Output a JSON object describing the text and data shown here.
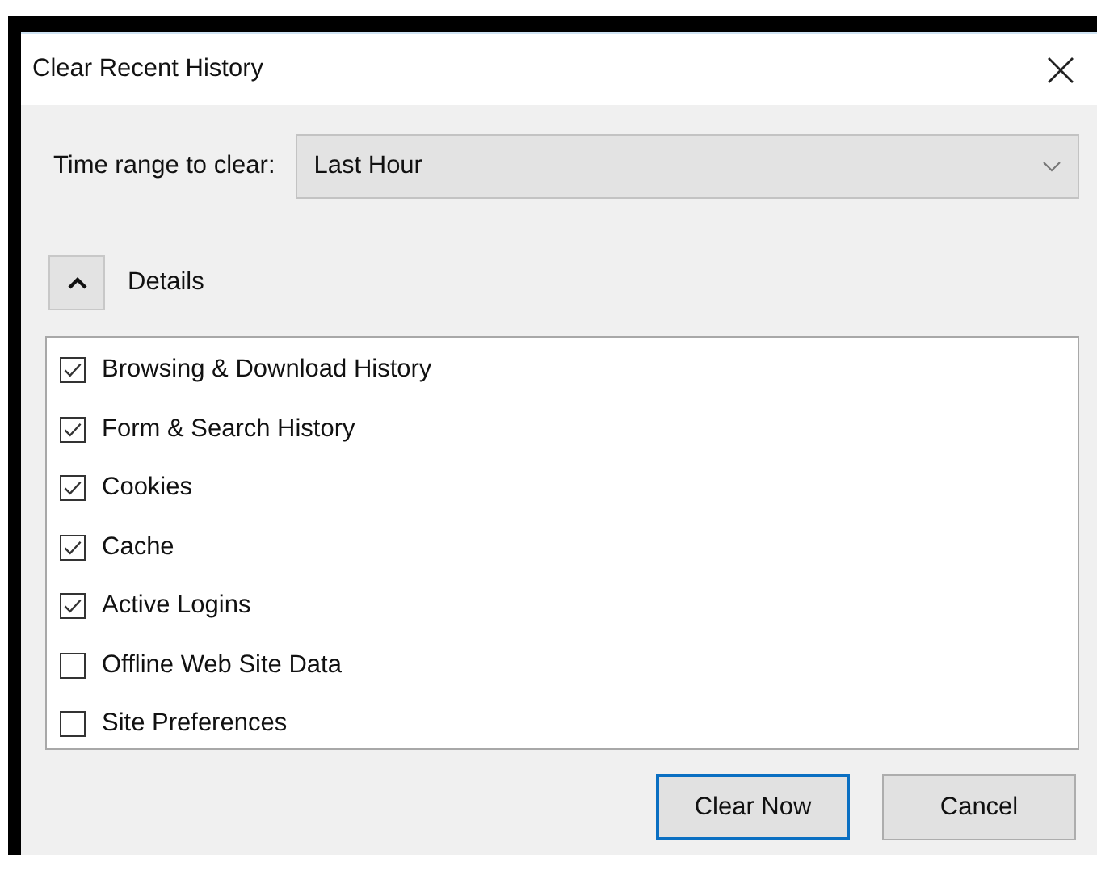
{
  "window": {
    "title": "Clear Recent History"
  },
  "time_range": {
    "label": "Time range to clear:",
    "value": "Last Hour"
  },
  "details": {
    "label": "Details",
    "expanded": true
  },
  "items": [
    {
      "label": "Browsing & Download History",
      "checked": true
    },
    {
      "label": "Form & Search History",
      "checked": true
    },
    {
      "label": "Cookies",
      "checked": true
    },
    {
      "label": "Cache",
      "checked": true
    },
    {
      "label": "Active Logins",
      "checked": true
    },
    {
      "label": "Offline Web Site Data",
      "checked": false
    },
    {
      "label": "Site Preferences",
      "checked": false
    }
  ],
  "buttons": [
    {
      "label": "Clear Now",
      "focused": true
    },
    {
      "label": "Cancel",
      "focused": false
    }
  ]
}
